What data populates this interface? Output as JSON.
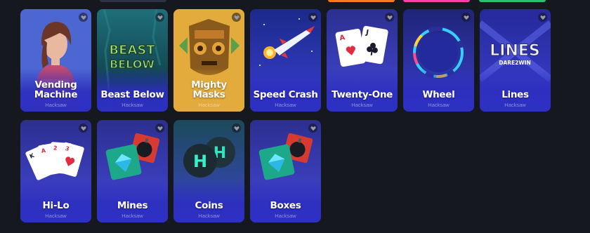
{
  "top_strip_colors": [
    "#2f3247",
    "#ff7a1a",
    "#ff3ea6",
    "#23c46b"
  ],
  "accent": "#2d30c4",
  "rows": [
    [
      {
        "title": "Vending Machine",
        "provider": "Hacksaw",
        "icon": "vending-machine-art"
      },
      {
        "title": "Beast Below",
        "provider": "Hacksaw",
        "icon": "beast-below-art"
      },
      {
        "title": "Mighty Masks",
        "provider": "Hacksaw",
        "icon": "mighty-masks-art"
      },
      {
        "title": "Speed Crash",
        "provider": "Hacksaw",
        "icon": "rocket-art"
      },
      {
        "title": "Twenty-One",
        "provider": "Hacksaw",
        "icon": "playing-cards-art"
      },
      {
        "title": "Wheel",
        "provider": "Hacksaw",
        "icon": "wheel-art"
      },
      {
        "title": "Lines",
        "provider": "Hacksaw",
        "icon": "lines-logo-art",
        "logo_text": "LINES",
        "logo_sub": "DARE2WIN"
      }
    ],
    [
      {
        "title": "Hi-Lo",
        "provider": "Hacksaw",
        "icon": "playing-cards-fan-art"
      },
      {
        "title": "Mines",
        "provider": "Hacksaw",
        "icon": "gem-and-bomb-art"
      },
      {
        "title": "Coins",
        "provider": "Hacksaw",
        "icon": "coins-art"
      },
      {
        "title": "Boxes",
        "provider": "Hacksaw",
        "icon": "gem-and-bomb-art"
      }
    ]
  ]
}
